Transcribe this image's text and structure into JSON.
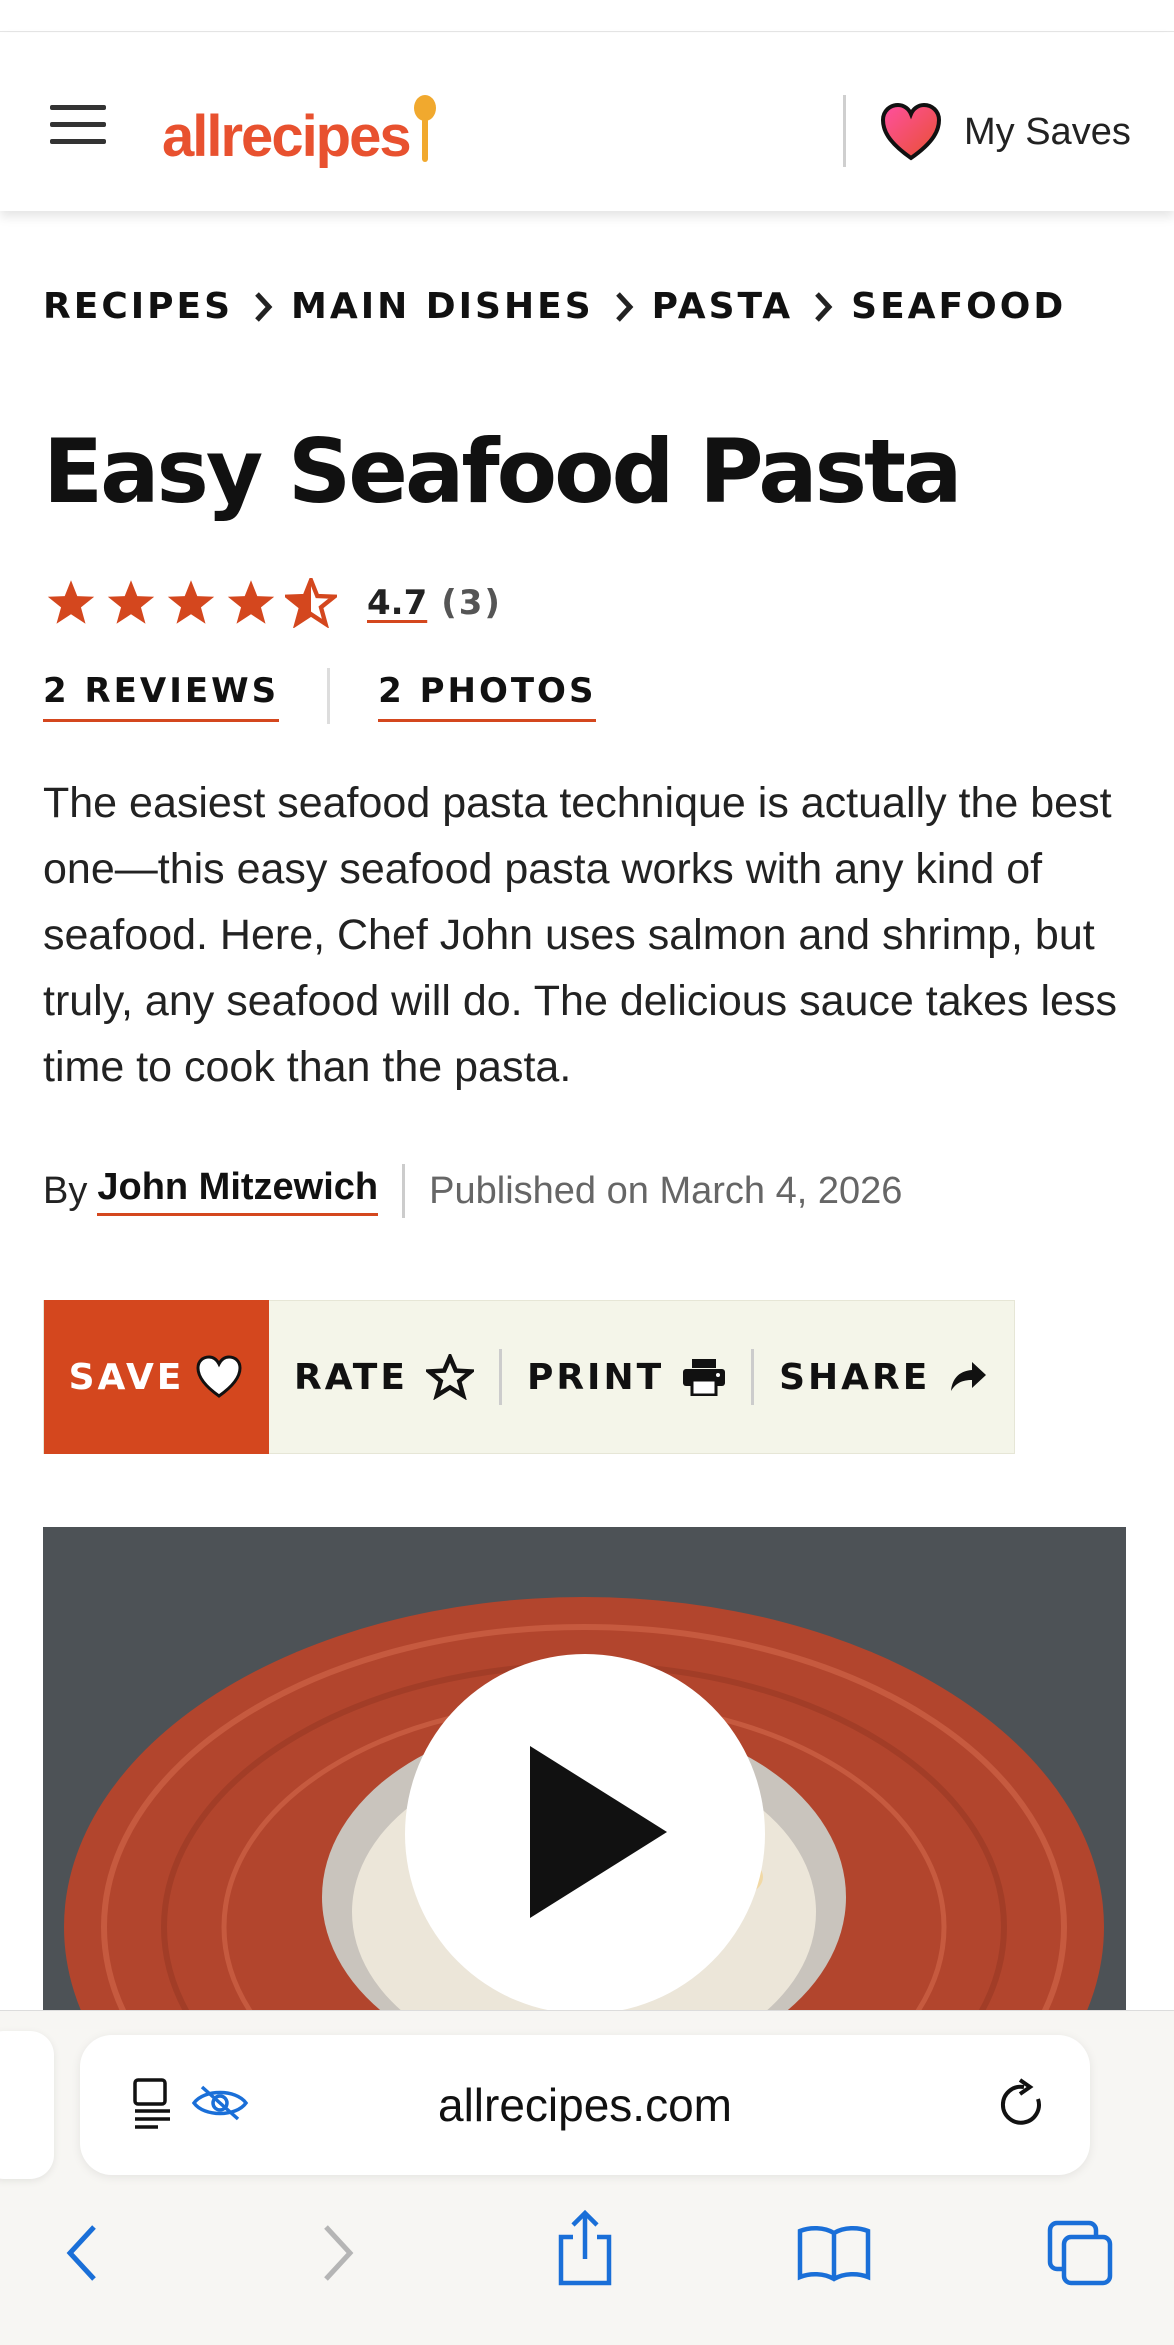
{
  "header": {
    "logo_text": "allrecipes",
    "my_saves_label": "My Saves",
    "colors": {
      "brand": "#e8512f",
      "accent": "#d4471e"
    }
  },
  "breadcrumb": [
    "RECIPES",
    "MAIN DISHES",
    "PASTA",
    "SEAFOOD"
  ],
  "recipe": {
    "title": "Easy Seafood Pasta",
    "rating": "4.7",
    "rating_count": "(3)",
    "stars_value": 4.5,
    "reviews_link": "2 REVIEWS",
    "photos_link": "2 PHOTOS",
    "description": "The easiest seafood pasta technique is actually the best one—this easy seafood pasta works with any kind of seafood. Here, Chef John uses salmon and shrimp, but truly, any seafood will do. The delicious sauce takes less time to cook than the pasta.",
    "by_label": "By",
    "author": "John Mitzewich",
    "published": "Published on March 4, 2026"
  },
  "actions": {
    "save": "SAVE",
    "rate": "RATE",
    "print": "PRINT",
    "share": "SHARE"
  },
  "video": {
    "play_icon": "play-icon"
  },
  "browser": {
    "url": "allrecipes.com",
    "icons": [
      "reader-icon",
      "privacy-eye-icon",
      "reload-icon",
      "back-icon",
      "forward-icon",
      "share-icon",
      "bookmarks-icon",
      "tabs-icon"
    ]
  }
}
